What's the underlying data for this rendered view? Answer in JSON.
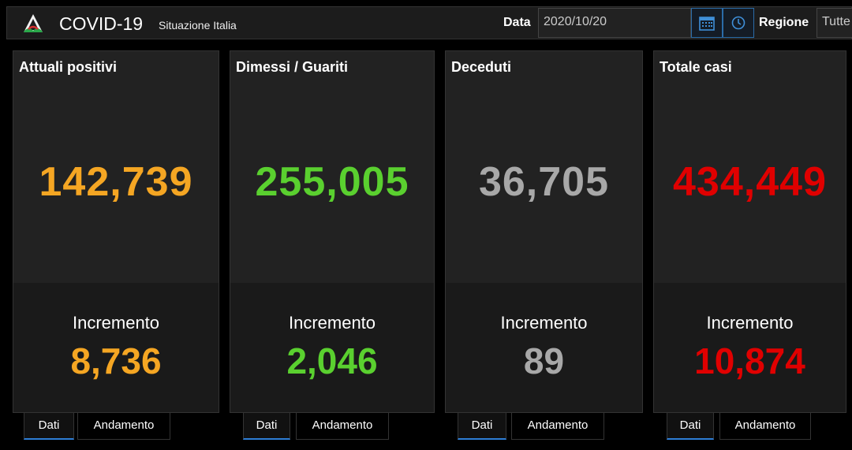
{
  "header": {
    "title": "COVID-19",
    "subtitle": "Situazione Italia",
    "date_label": "Data",
    "date_value": "2020/10/20",
    "calendar_icon": "calendar-icon",
    "clock_icon": "clock-icon",
    "region_label": "Regione",
    "region_value": "Tutte"
  },
  "cards": [
    {
      "title": "Attuali positivi",
      "value": "142,739",
      "increment_label": "Incremento",
      "increment": "8,736",
      "color": "#f5a623"
    },
    {
      "title": "Dimessi / Guariti",
      "value": "255,005",
      "increment_label": "Incremento",
      "increment": "2,046",
      "color": "#5ad02f"
    },
    {
      "title": "Deceduti",
      "value": "36,705",
      "increment_label": "Incremento",
      "increment": "89",
      "color": "#a8a8a8"
    },
    {
      "title": "Totale casi",
      "value": "434,449",
      "increment_label": "Incremento",
      "increment": "10,874",
      "color": "#e00000"
    }
  ],
  "tabs": [
    {
      "dati": "Dati",
      "andamento": "Andamento",
      "active": "Dati"
    },
    {
      "dati": "Dati",
      "andamento": "Andamento",
      "active": "Dati"
    },
    {
      "dati": "Dati",
      "andamento": "Andamento",
      "active": "Dati"
    },
    {
      "dati": "Dati",
      "andamento": "Andamento",
      "active": "Dati"
    }
  ],
  "accent_color": "#2e7ed6"
}
